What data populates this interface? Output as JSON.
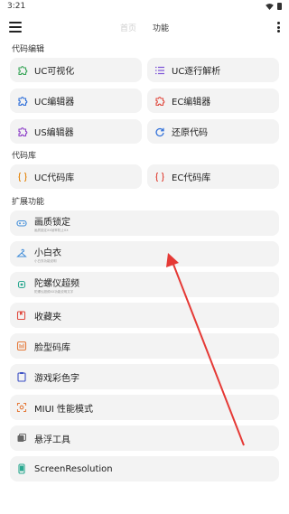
{
  "status_bar": {
    "time": "3:21"
  },
  "toolbar": {
    "tabs": [
      {
        "label": "首页"
      },
      {
        "label": "功能"
      }
    ]
  },
  "sections": {
    "code_edit": {
      "title": "代码编辑",
      "items": [
        {
          "label": "UC可视化",
          "icon": "puzzle-icon",
          "color": "#3aa65a"
        },
        {
          "label": "UC逐行解析",
          "icon": "list-icon",
          "color": "#7b52d6"
        },
        {
          "label": "UC编辑器",
          "icon": "puzzle-icon",
          "color": "#2f6fd9"
        },
        {
          "label": "EC编辑器",
          "icon": "puzzle-icon",
          "color": "#e04a3f"
        },
        {
          "label": "US编辑器",
          "icon": "puzzle-icon",
          "color": "#8d3fc8"
        },
        {
          "label": "还原代码",
          "icon": "refresh-icon",
          "color": "#2f6fd9"
        }
      ]
    },
    "code_lib": {
      "title": "代码库",
      "items": [
        {
          "label": "UC代码库",
          "icon": "braces-icon",
          "color": "#e58a16"
        },
        {
          "label": "EC代码库",
          "icon": "braces-icon",
          "color": "#e04a3f"
        }
      ]
    },
    "extensions": {
      "title": "扩展功能",
      "items": [
        {
          "label": "画质锁定",
          "sub": "画质锁定XX帧率防止XX",
          "icon": "gamepad-icon",
          "color": "#3d8bd8"
        },
        {
          "label": "小白衣",
          "sub": "小白衣功能说明",
          "icon": "hanger-icon",
          "color": "#3d8bd8"
        },
        {
          "label": "陀螺仪超频",
          "sub": "陀螺仪超频XX功能说明文字",
          "icon": "gyro-icon",
          "color": "#2aa890"
        },
        {
          "label": "收藏夹",
          "icon": "bookmark-icon",
          "color": "#e04a3f"
        },
        {
          "label": "脸型码库",
          "icon": "face-icon",
          "color": "#e57a3a"
        },
        {
          "label": "游戏彩色字",
          "icon": "clipboard-icon",
          "color": "#3b4fc4"
        },
        {
          "label": "MIUI 性能模式",
          "icon": "focus-icon",
          "color": "#e57a3a"
        },
        {
          "label": "悬浮工具",
          "icon": "layers-icon",
          "color": "#666666"
        },
        {
          "label": "ScreenResolution",
          "icon": "phone-icon",
          "color": "#2aa890"
        }
      ]
    }
  },
  "annotation": {
    "color": "#e53935"
  }
}
